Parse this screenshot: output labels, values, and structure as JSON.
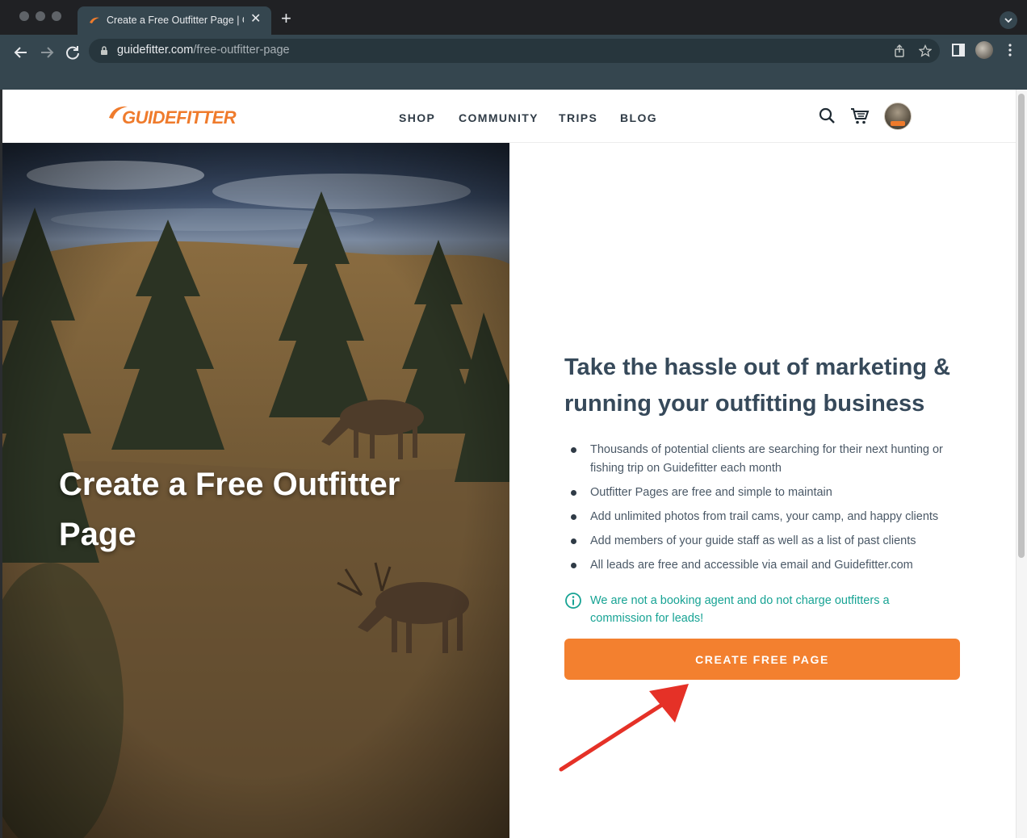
{
  "browser": {
    "tab_title": "Create a Free Outfitter Page | Guidefitter",
    "url_host": "guidefitter.com",
    "url_path": "/free-outfitter-page"
  },
  "site": {
    "logo_text": "GUIDEFITTER",
    "nav": [
      "SHOP",
      "COMMUNITY",
      "TRIPS",
      "BLOG"
    ],
    "icons": [
      "search-icon",
      "cart-icon",
      "user-avatar"
    ],
    "accent_color": "#f3802f",
    "teal_color": "#17a394"
  },
  "hero": {
    "title": "Create a Free Outfitter Page"
  },
  "content": {
    "headline": "Take the hassle out of marketing & running your outfitting business",
    "benefits": [
      "Thousands of potential clients are searching for their next hunting or fishing trip on Guidefitter each month",
      "Outfitter Pages are free and simple to maintain",
      "Add unlimited photos from trail cams, your camp, and happy clients",
      "Add members of your guide staff as well as a list of past clients",
      "All leads are free and accessible via email and Guidefitter.com"
    ],
    "notice": "We are not a booking agent and do not charge outfitters a commission for leads!",
    "cta_label": "CREATE FREE PAGE"
  }
}
